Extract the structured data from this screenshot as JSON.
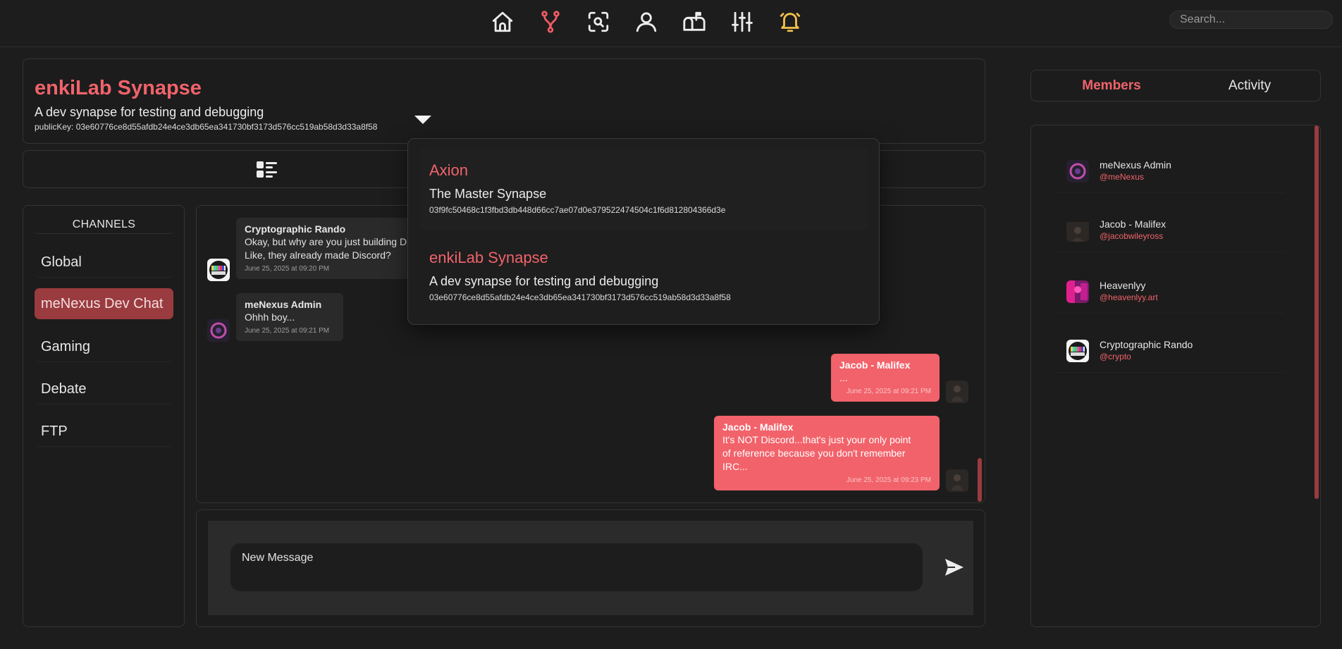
{
  "nav": {
    "icons": [
      "home-icon",
      "fork-icon",
      "scan-search-icon",
      "profile-icon",
      "mailbox-icon",
      "sliders-icon",
      "bell-icon"
    ]
  },
  "search": {
    "placeholder": "Search..."
  },
  "synapse": {
    "title": "enkiLab Synapse",
    "description": "A dev synapse for testing and debugging",
    "public_key": "publicKey: 03e60776ce8d55afdb24e4ce3db65ea341730bf3173d576cc519ab58d3d33a8f58"
  },
  "channels": {
    "heading": "CHANNELS",
    "items": [
      "Global",
      "meNexus Dev Chat",
      "Gaming",
      "Debate",
      "FTP"
    ],
    "active": "meNexus Dev Chat"
  },
  "messages": [
    {
      "author": "Cryptographic Rando",
      "lines": [
        "Okay, but why are you just building Discord?",
        "Like, they already made Discord?"
      ],
      "time": "June 25, 2025 at 09:20 PM",
      "direction": "in"
    },
    {
      "author": "meNexus Admin",
      "lines": [
        "Ohhh boy..."
      ],
      "time": "June 25, 2025 at 09:21 PM",
      "direction": "in"
    },
    {
      "author": "Jacob - Malifex",
      "lines": [
        "..."
      ],
      "time": "June 25, 2025 at 09:21 PM",
      "direction": "out"
    },
    {
      "author": "Jacob - Malifex",
      "lines": [
        "It's NOT Discord...that's just your only point",
        "of reference because you don't remember",
        "IRC..."
      ],
      "time": "June 25, 2025 at 09:23 PM",
      "direction": "out"
    }
  ],
  "composer": {
    "placeholder": "New Message"
  },
  "side_tabs": {
    "members": "Members",
    "activity": "Activity",
    "active": "Members"
  },
  "members": [
    {
      "name": "meNexus Admin",
      "handle": "@meNexus"
    },
    {
      "name": "Jacob - Malifex",
      "handle": "@jacobwileyross"
    },
    {
      "name": "Heavenlyy",
      "handle": "@heavenlyy.art"
    },
    {
      "name": "Cryptographic Rando",
      "handle": "@crypto"
    }
  ],
  "synapse_menu": [
    {
      "name": "Axion",
      "description": "The Master Synapse",
      "key": "03f9fc50468c1f3fbd3db448d66cc7ae07d0e379522474504c1f6d812804366d3e"
    },
    {
      "name": "enkiLab Synapse",
      "description": "A dev synapse for testing and debugging",
      "key": "03e60776ce8d55afdb24e4ce3db65ea341730bf3173d576cc519ab58d3d33a8f58"
    }
  ],
  "colors": {
    "accent": "#f0636b",
    "bubble_out": "#f2626a",
    "active_channel": "#9a3b3f",
    "bell": "#f1c14b",
    "background": "#1d1d1d"
  }
}
